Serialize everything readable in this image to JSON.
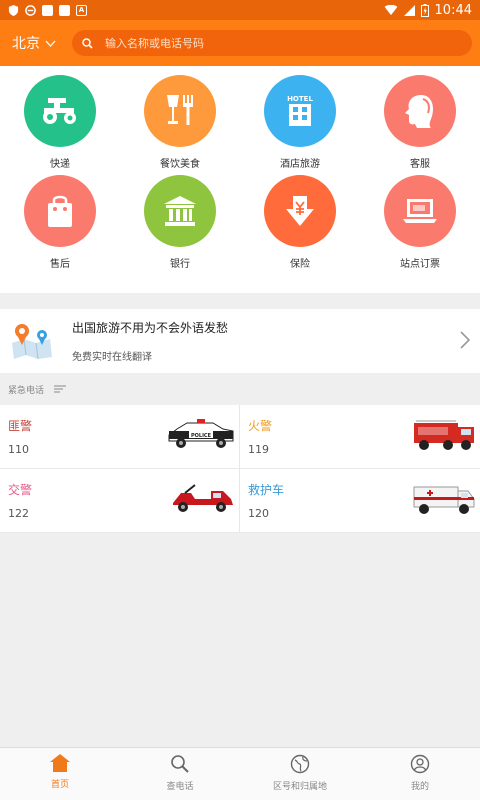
{
  "status_bar": {
    "time": "10:44"
  },
  "header": {
    "city": "北京",
    "search_placeholder": "输入名称或电话号码"
  },
  "colors": {
    "accent": "#ff7e14",
    "green": "#25c18a",
    "orange": "#ff9a3c",
    "blue": "#3cb2f0",
    "salmon": "#fa7a6e",
    "olive": "#8fc43e",
    "red_orange": "#ff6b3a"
  },
  "services": [
    {
      "label": "快递",
      "icon": "tractor-icon"
    },
    {
      "label": "餐饮美食",
      "icon": "dining-icon"
    },
    {
      "label": "酒店旅游",
      "icon": "hotel-icon"
    },
    {
      "label": "客服",
      "icon": "customer-service-icon"
    },
    {
      "label": "售后",
      "icon": "shopping-bag-icon"
    },
    {
      "label": "银行",
      "icon": "bank-icon"
    },
    {
      "label": "保险",
      "icon": "insurance-icon"
    },
    {
      "label": "站点订票",
      "icon": "laptop-icon"
    }
  ],
  "hotel_sign": "HOTEL",
  "banner": {
    "title": "出国旅游不用为不会外语发愁",
    "subtitle": "免费实时在线翻译"
  },
  "emergency": {
    "header": "紧急电话",
    "items": [
      {
        "name": "匪警",
        "number": "110",
        "color": "#c8443a"
      },
      {
        "name": "火警",
        "number": "119",
        "color": "#f29b1c"
      },
      {
        "name": "交警",
        "number": "122",
        "color": "#e85a8a"
      },
      {
        "name": "救护车",
        "number": "120",
        "color": "#3a9bd8"
      }
    ],
    "police_text": "POLICE"
  },
  "nav": [
    {
      "label": "首页",
      "icon": "home-icon",
      "active": true
    },
    {
      "label": "查电话",
      "icon": "search-phone-icon",
      "active": false
    },
    {
      "label": "区号和归属地",
      "icon": "globe-icon",
      "active": false
    },
    {
      "label": "我的",
      "icon": "user-icon",
      "active": false
    }
  ]
}
